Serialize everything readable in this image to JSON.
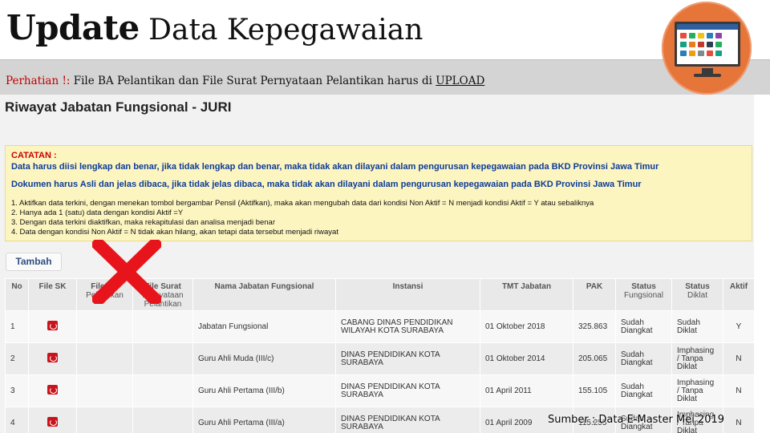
{
  "slide": {
    "title_strong": "Update",
    "title_rest": " Data Kepegawaian",
    "notice_warn": "Perhatian !:",
    "notice_text": " File BA Pelantikan dan File Surat Pernyataan Pelantikan harus di ",
    "notice_upload": "UPLOAD",
    "source_caption": "Sumber : Data E-Master Mei 2019",
    "accent_color": "#e6753a"
  },
  "screen": {
    "heading": "Riwayat Jabatan Fungsional - JURI",
    "catatan": {
      "title": "CATATAN :",
      "line1": "Data harus diisi lengkap dan benar, jika tidak lengkap dan benar, maka tidak akan dilayani dalam pengurusan kepegawaian pada BKD Provinsi Jawa Timur",
      "line2": "Dokumen harus Asli dan jelas dibaca, jika tidak jelas dibaca, maka tidak akan dilayani dalam pengurusan kepegawaian pada BKD Provinsi Jawa Timur",
      "items": [
        "1. Aktifkan data terkini, dengan menekan tombol bergambar Pensil (Aktifkan), maka akan mengubah data dari kondisi Non Aktif = N menjadi kondisi Aktif = Y atau sebaliknya",
        "2. Hanya ada 1 (satu) data dengan kondisi Aktif =Y",
        "3. Dengan data terkini diaktifkan, maka rekapitulasi dan analisa menjadi benar",
        "4. Data dengan kondisi Non Aktif = N tidak akan hilang, akan tetapi data tersebut menjadi riwayat"
      ]
    },
    "add_button": "Tambah",
    "columns": [
      "No",
      "File SK",
      "File BA",
      "Pelantikan",
      "File Surat",
      "Pernyataan",
      "Pelantikan",
      "Nama Jabatan Fungsional",
      "Instansi",
      "TMT Jabatan",
      "PAK",
      "Status",
      "Fungsional",
      "Status",
      "Diklat",
      "Aktif"
    ],
    "rows": [
      {
        "no": "1",
        "jabatan": "Jabatan Fungsional",
        "instansi": "CABANG DINAS PENDIDIKAN WILAYAH KOTA SURABAYA",
        "tmt": "01 Oktober 2018",
        "pak": "325.863",
        "status_fungsional": "Sudah Diangkat",
        "status_diklat": "Sudah Diklat",
        "aktif": "Y"
      },
      {
        "no": "2",
        "jabatan": "Guru Ahli Muda (III/c)",
        "instansi": "DINAS PENDIDIKAN KOTA SURABAYA",
        "tmt": "01 Oktober 2014",
        "pak": "205.065",
        "status_fungsional": "Sudah Diangkat",
        "status_diklat": "Imphasing / Tanpa Diklat",
        "aktif": "N"
      },
      {
        "no": "3",
        "jabatan": "Guru Ahli Pertama (III/b)",
        "instansi": "DINAS PENDIDIKAN KOTA SURABAYA",
        "tmt": "01 April 2011",
        "pak": "155.105",
        "status_fungsional": "Sudah Diangkat",
        "status_diklat": "Imphasing / Tanpa Diklat",
        "aktif": "N"
      },
      {
        "no": "4",
        "jabatan": "Guru Ahli Pertama (III/a)",
        "instansi": "DINAS PENDIDIKAN KOTA SURABAYA",
        "tmt": "01 April 2009",
        "pak": "115.255",
        "status_fungsional": "Sudah Diangkat",
        "status_diklat": "Imphasing / Tanpa Diklat",
        "aktif": "N"
      }
    ]
  }
}
